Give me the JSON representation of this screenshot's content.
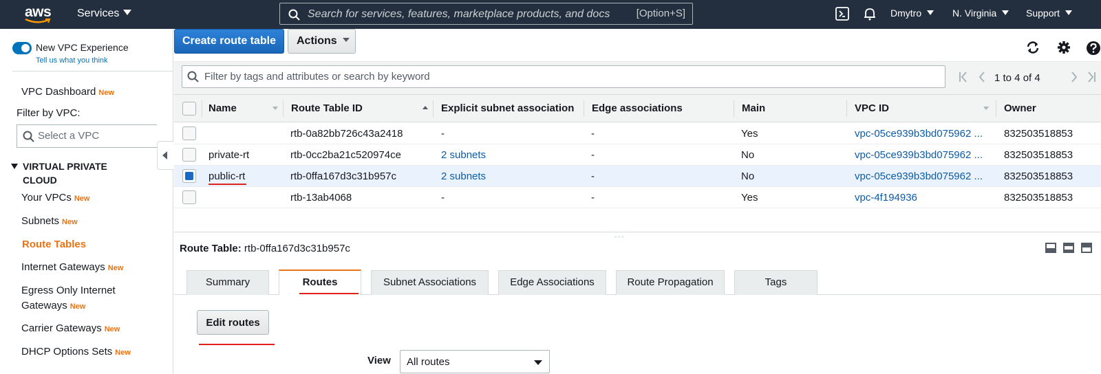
{
  "topnav": {
    "logo_text": "aws",
    "services_label": "Services",
    "search_placeholder": "Search for services, features, marketplace products, and docs",
    "search_shortcut": "[Option+S]",
    "user": "Dmytro",
    "region": "N. Virginia",
    "support": "Support",
    "icons": [
      "cloudshell-icon",
      "bell-icon"
    ]
  },
  "sidebar": {
    "toggle_label": "New VPC Experience",
    "tell_us": "Tell us what you think",
    "dashboard": {
      "label": "VPC Dashboard",
      "badge": "New"
    },
    "filter_label": "Filter by VPC:",
    "filter_placeholder": "Select a VPC",
    "section_title": "VIRTUAL PRIVATE CLOUD",
    "items": [
      {
        "label": "Your VPCs",
        "badge": "New"
      },
      {
        "label": "Subnets",
        "badge": "New"
      },
      {
        "label": "Route Tables",
        "badge": ""
      },
      {
        "label": "Internet Gateways",
        "badge": "New"
      },
      {
        "label": "Egress Only Internet Gateways",
        "badge": "New"
      },
      {
        "label": "Carrier Gateways",
        "badge": "New"
      },
      {
        "label": "DHCP Options Sets",
        "badge": "New"
      }
    ]
  },
  "toolbar": {
    "create_label": "Create route table",
    "actions_label": "Actions"
  },
  "filter": {
    "placeholder": "Filter by tags and attributes or search by keyword",
    "pagination": "1 to 4 of 4"
  },
  "table": {
    "columns": [
      "Name",
      "Route Table ID",
      "Explicit subnet association",
      "Edge associations",
      "Main",
      "VPC ID",
      "Owner"
    ],
    "rows": [
      {
        "name": "",
        "id": "rtb-0a82bb726c43a2418",
        "subnet": "-",
        "edge": "-",
        "main": "Yes",
        "vpc": "vpc-05ce939b3bd075962 ...",
        "owner": "832503518853",
        "selected": false
      },
      {
        "name": "private-rt",
        "id": "rtb-0cc2ba21c520974ce",
        "subnet": "2 subnets",
        "edge": "-",
        "main": "No",
        "vpc": "vpc-05ce939b3bd075962 ...",
        "owner": "832503518853",
        "selected": false
      },
      {
        "name": "public-rt",
        "id": "rtb-0ffa167d3c31b957c",
        "subnet": "2 subnets",
        "edge": "-",
        "main": "No",
        "vpc": "vpc-05ce939b3bd075962 ...",
        "owner": "832503518853",
        "selected": true
      },
      {
        "name": "",
        "id": "rtb-13ab4068",
        "subnet": "-",
        "edge": "-",
        "main": "Yes",
        "vpc": "vpc-4f194936",
        "owner": "832503518853",
        "selected": false
      }
    ]
  },
  "detail": {
    "label": "Route Table:",
    "value": "rtb-0ffa167d3c31b957c",
    "tabs": [
      "Summary",
      "Routes",
      "Subnet Associations",
      "Edge Associations",
      "Route Propagation",
      "Tags"
    ],
    "active_tab": "Routes",
    "edit_label": "Edit routes",
    "view_label": "View",
    "view_value": "All routes"
  },
  "colors": {
    "nav_bg": "#232f3e",
    "accent": "#ec7211",
    "primary": "#1c6ec7",
    "link": "#0b5ba8",
    "annotation": "#e0211a"
  }
}
